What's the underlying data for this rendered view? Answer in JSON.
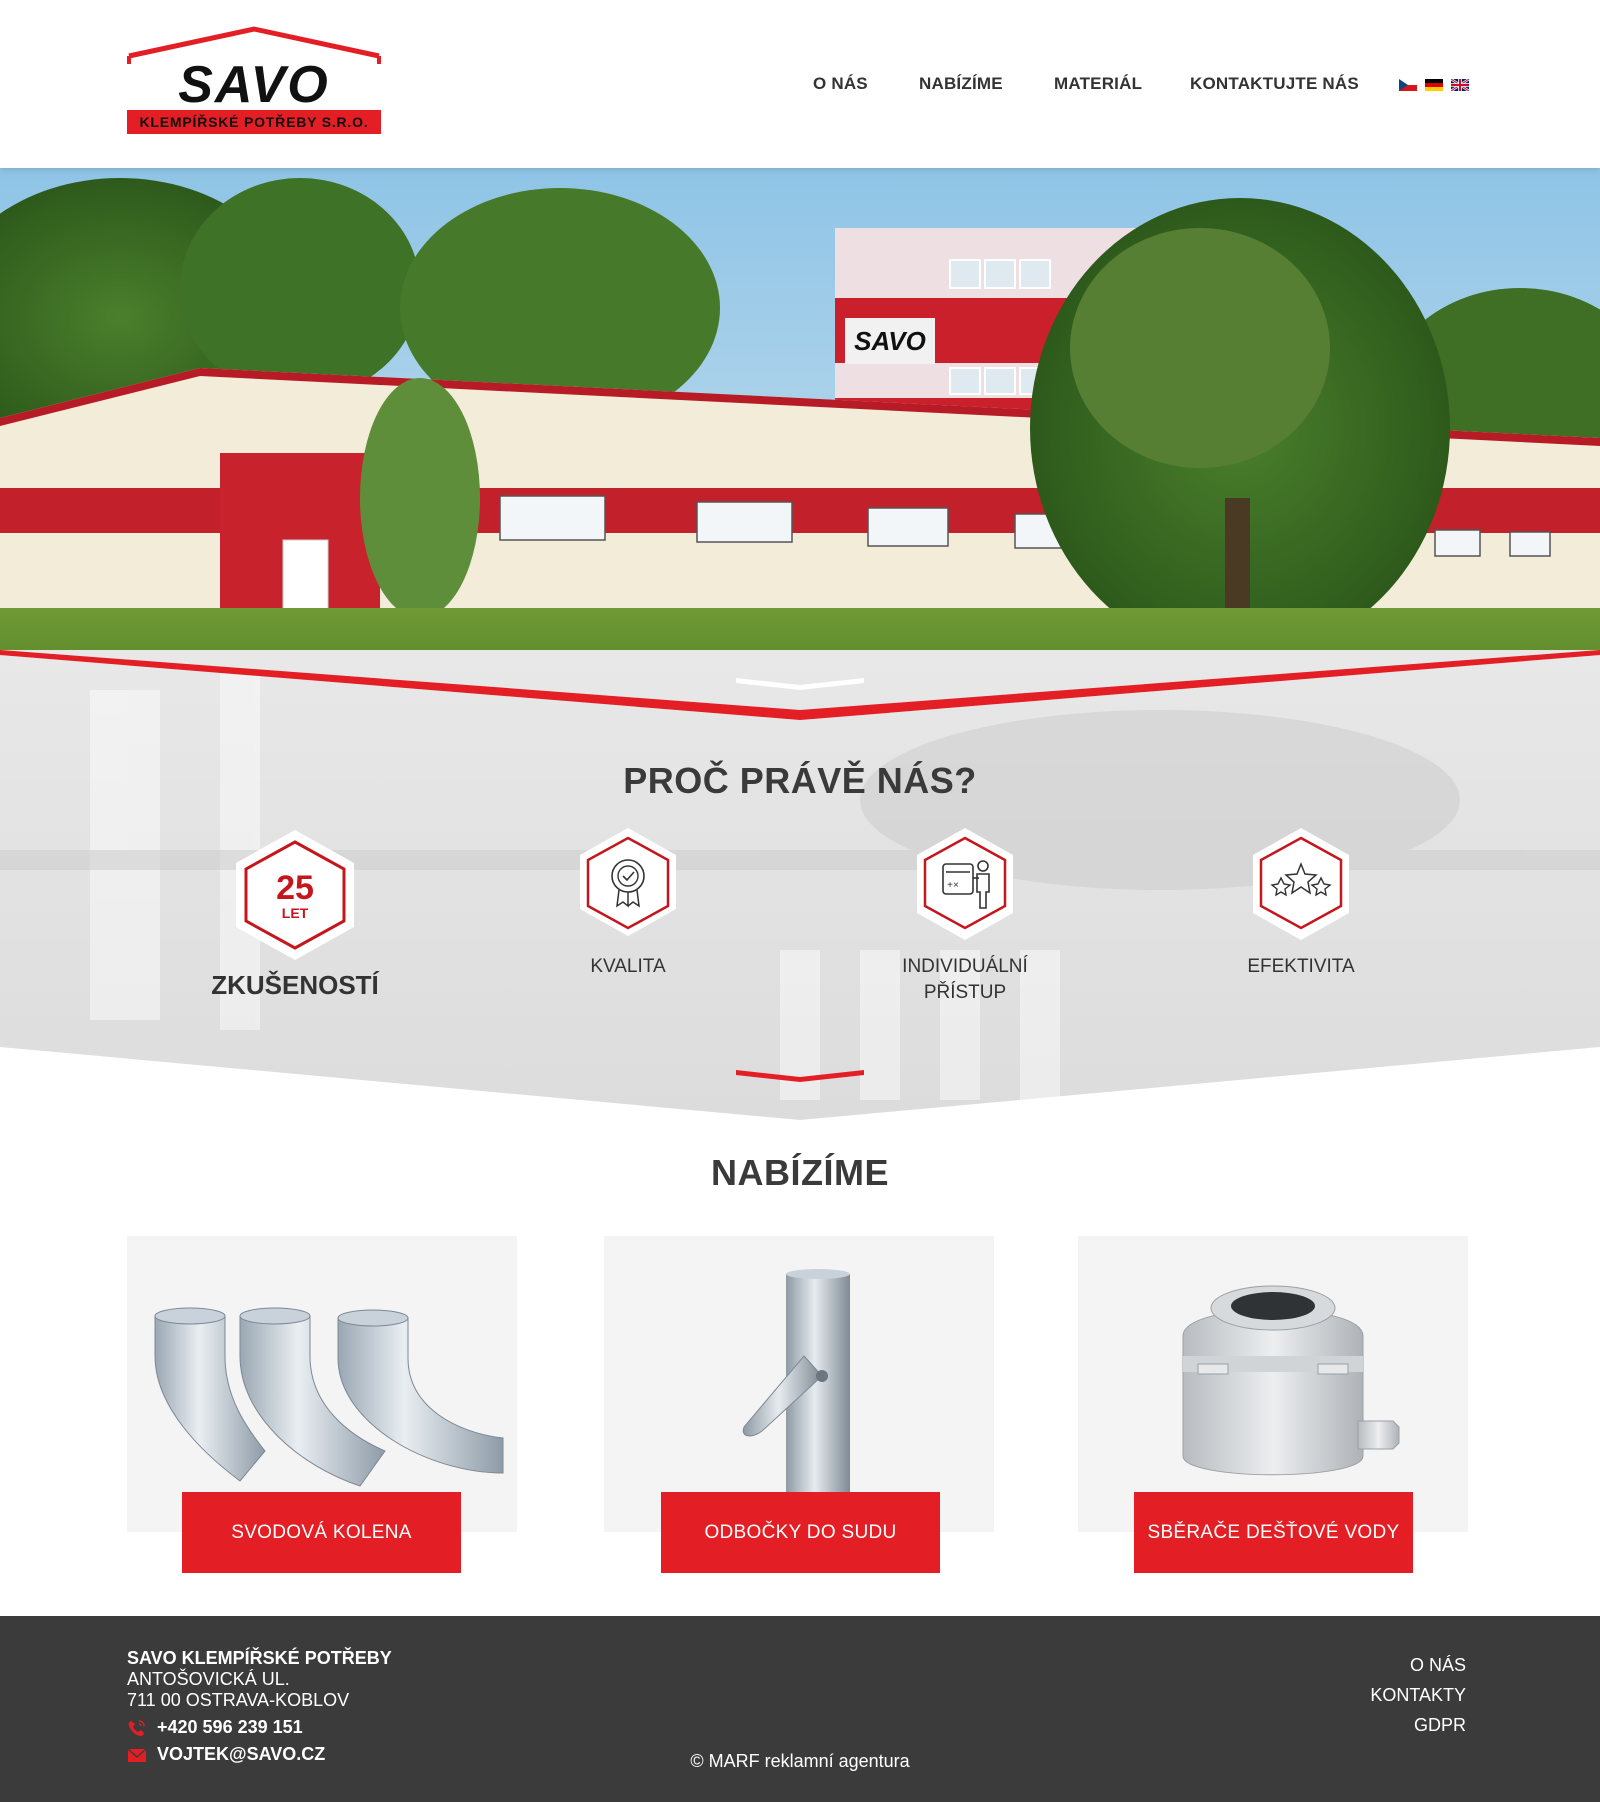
{
  "brand": {
    "logo_word": "SAVO",
    "logo_sub": "KLEMPÍŘSKÉ POTŘEBY S.R.O.",
    "colors": {
      "red": "#e31e24",
      "dark": "#333333",
      "footer": "#3b3b3b",
      "card_bg": "#f4f4f4"
    }
  },
  "nav": {
    "items": [
      {
        "label": "O NÁS"
      },
      {
        "label": "NABÍZÍME"
      },
      {
        "label": "MATERIÁL"
      },
      {
        "label": "KONTAKTUJTE NÁS"
      }
    ],
    "languages": [
      "czech-flag-icon",
      "german-flag-icon",
      "uk-flag-icon"
    ]
  },
  "hero": {
    "image": "savo-building-photo",
    "building_sign": "SAVO"
  },
  "why": {
    "title": "PROČ PRÁVĚ NÁS?",
    "features": [
      {
        "number": "25",
        "unit": "LET",
        "label": "ZKUŠENOSTÍ",
        "icon": "years-badge-icon"
      },
      {
        "label": "KVALITA",
        "icon": "quality-rosette-icon"
      },
      {
        "label_line1": "INDIVIDUÁLNÍ",
        "label_line2": "PŘÍSTUP",
        "icon": "consultant-icon"
      },
      {
        "label": "EFEKTIVITA",
        "icon": "three-stars-icon"
      }
    ]
  },
  "offers": {
    "title": "NABÍZÍME",
    "cards": [
      {
        "label": "SVODOVÁ KOLENA",
        "image": "downpipe-elbows-image"
      },
      {
        "label": "ODBOČKY DO SUDU",
        "image": "rain-diverter-image"
      },
      {
        "label": "SBĚRAČE DEŠŤOVÉ VODY",
        "image": "rainwater-collector-image"
      }
    ]
  },
  "footer": {
    "company": "SAVO KLEMPÍŘSKÉ POTŘEBY",
    "street": "ANTOŠOVICKÁ UL.",
    "city": "711 00 OSTRAVA-KOBLOV",
    "phone": "+420 596 239 151",
    "email": "VOJTEK@SAVO.CZ",
    "copyright": "© MARF reklamní agentura",
    "links": [
      {
        "label": "O NÁS"
      },
      {
        "label": "KONTAKTY"
      },
      {
        "label": "GDPR"
      }
    ]
  }
}
